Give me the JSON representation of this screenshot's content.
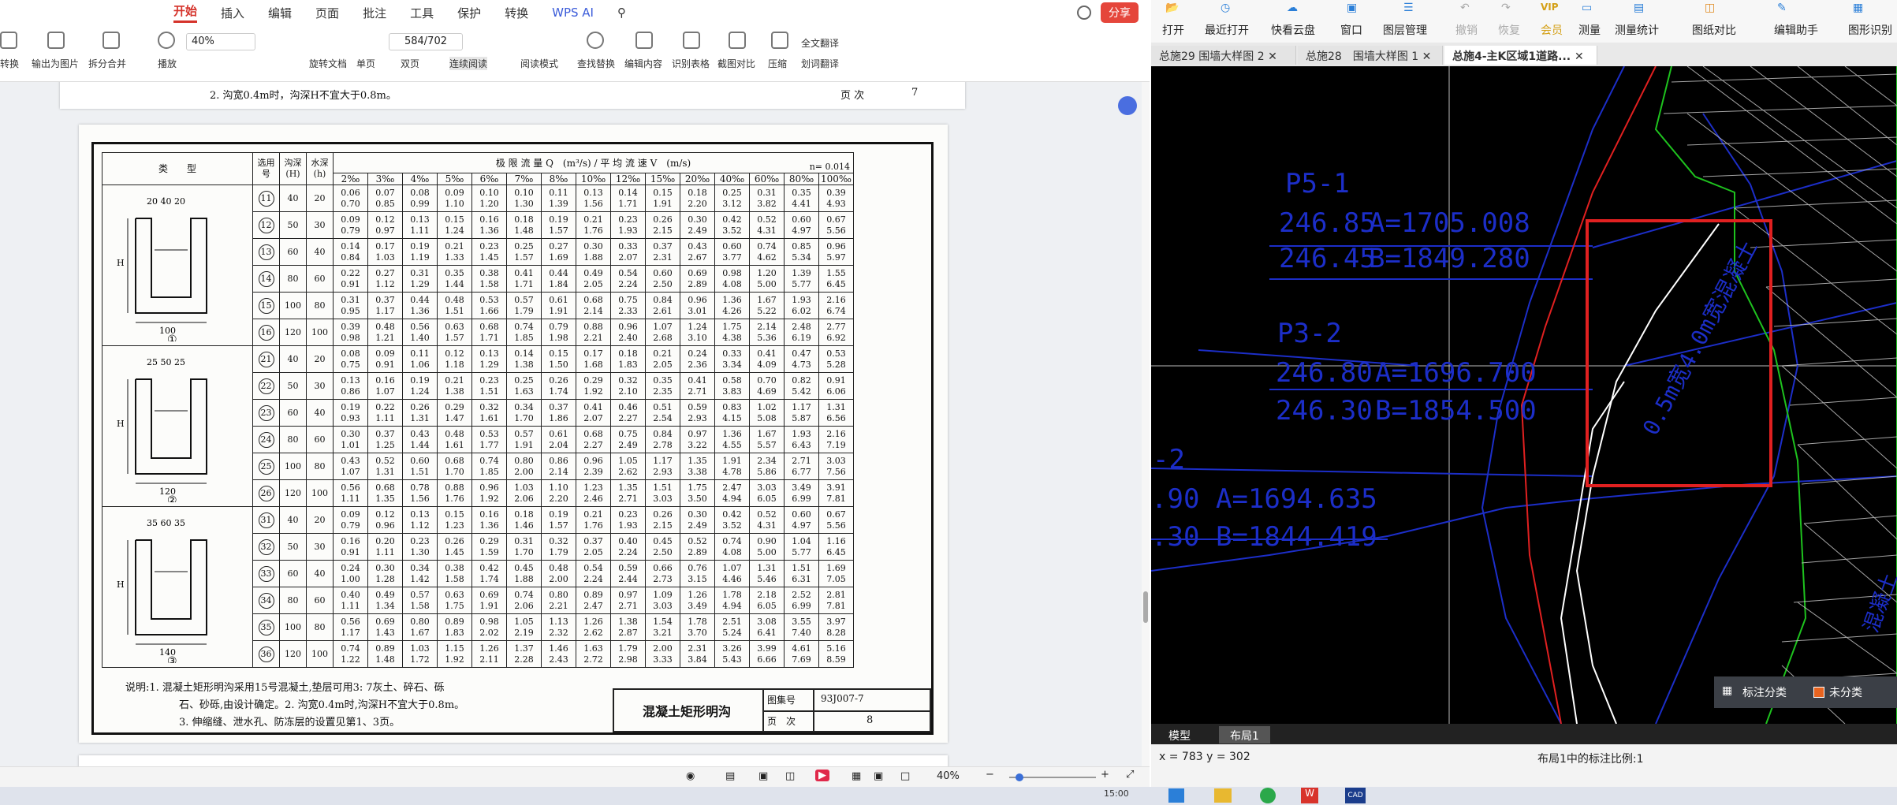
{
  "wps": {
    "menu": [
      "开始",
      "插入",
      "编辑",
      "页面",
      "批注",
      "工具",
      "保护",
      "转换",
      "WPS AI"
    ],
    "share_label": "分享",
    "ribbon": {
      "convert": "转换",
      "export_image": "输出为图片",
      "split_merge": "拆分合并",
      "play": "播放",
      "zoom": "40%",
      "page": "584/702",
      "rotate": "旋转文档",
      "single": "单页",
      "double": "双页",
      "continuous": "连续阅读",
      "read_mode": "阅读模式",
      "find_replace": "查找替换",
      "edit_content": "编辑内容",
      "recognize_table": "识别表格",
      "screenshot_compare": "截图对比",
      "compress": "压缩",
      "full_translate": "全文翻译",
      "word_translate": "划词翻译"
    },
    "prev_page": {
      "note": "2. 沟宽0.4m时，沟深H不宜大于0.8m。",
      "page_label": "页 次",
      "page_no": "7"
    },
    "drawing": {
      "header_type": "类　　型",
      "header_select": "选用号",
      "header_depth": "沟深(H)",
      "header_water": "水深(h)",
      "header_main": "极 限 流 量 Q　(m³/s) / 平 均 流 速 V　(m/s)",
      "n_value": "n= 0.014",
      "slopes": [
        "2‰",
        "3‰",
        "4‰",
        "5‰",
        "6‰",
        "7‰",
        "8‰",
        "10‰",
        "12‰",
        "15‰",
        "20‰",
        "40‰",
        "60‰",
        "80‰",
        "100‰"
      ],
      "groups": [
        {
          "label": "①",
          "dims": "20 40 20",
          "bottom": "100",
          "rows": [
            {
              "no": "11",
              "H": "40",
              "h": "20",
              "q": [
                "0.06",
                "0.07",
                "0.08",
                "0.09",
                "0.10",
                "0.10",
                "0.11",
                "0.13",
                "0.14",
                "0.15",
                "0.18",
                "0.25",
                "0.31",
                "0.35",
                "0.39"
              ],
              "v": [
                "0.70",
                "0.85",
                "0.99",
                "1.10",
                "1.20",
                "1.30",
                "1.39",
                "1.56",
                "1.71",
                "1.91",
                "2.20",
                "3.12",
                "3.82",
                "4.41",
                "4.93"
              ]
            },
            {
              "no": "12",
              "H": "50",
              "h": "30",
              "q": [
                "0.09",
                "0.12",
                "0.13",
                "0.15",
                "0.16",
                "0.18",
                "0.19",
                "0.21",
                "0.23",
                "0.26",
                "0.30",
                "0.42",
                "0.52",
                "0.60",
                "0.67"
              ],
              "v": [
                "0.79",
                "0.97",
                "1.11",
                "1.24",
                "1.36",
                "1.48",
                "1.57",
                "1.76",
                "1.93",
                "2.15",
                "2.49",
                "3.52",
                "4.31",
                "4.97",
                "5.56"
              ]
            },
            {
              "no": "13",
              "H": "60",
              "h": "40",
              "q": [
                "0.14",
                "0.17",
                "0.19",
                "0.21",
                "0.23",
                "0.25",
                "0.27",
                "0.30",
                "0.33",
                "0.37",
                "0.43",
                "0.60",
                "0.74",
                "0.85",
                "0.96"
              ],
              "v": [
                "0.84",
                "1.03",
                "1.19",
                "1.33",
                "1.45",
                "1.57",
                "1.69",
                "1.88",
                "2.07",
                "2.31",
                "2.67",
                "3.77",
                "4.62",
                "5.34",
                "5.97"
              ]
            },
            {
              "no": "14",
              "H": "80",
              "h": "60",
              "q": [
                "0.22",
                "0.27",
                "0.31",
                "0.35",
                "0.38",
                "0.41",
                "0.44",
                "0.49",
                "0.54",
                "0.60",
                "0.69",
                "0.98",
                "1.20",
                "1.39",
                "1.55"
              ],
              "v": [
                "0.91",
                "1.12",
                "1.29",
                "1.44",
                "1.58",
                "1.71",
                "1.84",
                "2.05",
                "2.24",
                "2.50",
                "2.89",
                "4.08",
                "5.00",
                "5.77",
                "6.45"
              ]
            },
            {
              "no": "15",
              "H": "100",
              "h": "80",
              "q": [
                "0.31",
                "0.37",
                "0.44",
                "0.48",
                "0.53",
                "0.57",
                "0.61",
                "0.68",
                "0.75",
                "0.84",
                "0.96",
                "1.36",
                "1.67",
                "1.93",
                "2.16"
              ],
              "v": [
                "0.95",
                "1.17",
                "1.36",
                "1.51",
                "1.66",
                "1.79",
                "1.91",
                "2.14",
                "2.33",
                "2.61",
                "3.01",
                "4.26",
                "5.22",
                "6.02",
                "6.74"
              ]
            },
            {
              "no": "16",
              "H": "120",
              "h": "100",
              "q": [
                "0.39",
                "0.48",
                "0.56",
                "0.63",
                "0.68",
                "0.74",
                "0.79",
                "0.88",
                "0.96",
                "1.07",
                "1.24",
                "1.75",
                "2.14",
                "2.48",
                "2.77"
              ],
              "v": [
                "0.98",
                "1.21",
                "1.40",
                "1.57",
                "1.71",
                "1.85",
                "1.98",
                "2.21",
                "2.40",
                "2.68",
                "3.10",
                "4.38",
                "5.36",
                "6.19",
                "6.92"
              ]
            }
          ]
        },
        {
          "label": "②",
          "dims": "25 50 25",
          "bottom": "120",
          "rows": [
            {
              "no": "21",
              "H": "40",
              "h": "20",
              "q": [
                "0.08",
                "0.09",
                "0.11",
                "0.12",
                "0.13",
                "0.14",
                "0.15",
                "0.17",
                "0.18",
                "0.21",
                "0.24",
                "0.33",
                "0.41",
                "0.47",
                "0.53"
              ],
              "v": [
                "0.75",
                "0.91",
                "1.06",
                "1.18",
                "1.29",
                "1.38",
                "1.50",
                "1.68",
                "1.83",
                "2.05",
                "2.36",
                "3.34",
                "4.09",
                "4.73",
                "5.28"
              ]
            },
            {
              "no": "22",
              "H": "50",
              "h": "30",
              "q": [
                "0.13",
                "0.16",
                "0.19",
                "0.21",
                "0.23",
                "0.25",
                "0.26",
                "0.29",
                "0.32",
                "0.35",
                "0.41",
                "0.58",
                "0.70",
                "0.82",
                "0.91"
              ],
              "v": [
                "0.86",
                "1.07",
                "1.24",
                "1.38",
                "1.51",
                "1.63",
                "1.74",
                "1.92",
                "2.10",
                "2.35",
                "2.71",
                "3.83",
                "4.69",
                "5.42",
                "6.06"
              ]
            },
            {
              "no": "23",
              "H": "60",
              "h": "40",
              "q": [
                "0.19",
                "0.22",
                "0.26",
                "0.29",
                "0.32",
                "0.34",
                "0.37",
                "0.41",
                "0.46",
                "0.51",
                "0.59",
                "0.83",
                "1.02",
                "1.17",
                "1.31"
              ],
              "v": [
                "0.93",
                "1.11",
                "1.31",
                "1.47",
                "1.61",
                "1.70",
                "1.86",
                "2.07",
                "2.27",
                "2.54",
                "2.93",
                "4.15",
                "5.08",
                "5.87",
                "6.56"
              ]
            },
            {
              "no": "24",
              "H": "80",
              "h": "60",
              "q": [
                "0.30",
                "0.37",
                "0.43",
                "0.48",
                "0.53",
                "0.57",
                "0.61",
                "0.68",
                "0.75",
                "0.84",
                "0.97",
                "1.36",
                "1.67",
                "1.93",
                "2.16"
              ],
              "v": [
                "1.01",
                "1.25",
                "1.44",
                "1.61",
                "1.77",
                "1.91",
                "2.04",
                "2.27",
                "2.49",
                "2.78",
                "3.22",
                "4.55",
                "5.57",
                "6.43",
                "7.19"
              ]
            },
            {
              "no": "25",
              "H": "100",
              "h": "80",
              "q": [
                "0.43",
                "0.52",
                "0.60",
                "0.68",
                "0.74",
                "0.80",
                "0.86",
                "0.96",
                "1.05",
                "1.17",
                "1.35",
                "1.91",
                "2.34",
                "2.71",
                "3.03"
              ],
              "v": [
                "1.07",
                "1.31",
                "1.51",
                "1.70",
                "1.85",
                "2.00",
                "2.14",
                "2.39",
                "2.62",
                "2.93",
                "3.38",
                "4.78",
                "5.86",
                "6.77",
                "7.56"
              ]
            },
            {
              "no": "26",
              "H": "120",
              "h": "100",
              "q": [
                "0.56",
                "0.68",
                "0.78",
                "0.88",
                "0.96",
                "1.03",
                "1.10",
                "1.23",
                "1.35",
                "1.51",
                "1.75",
                "2.47",
                "3.03",
                "3.49",
                "3.91"
              ],
              "v": [
                "1.11",
                "1.35",
                "1.56",
                "1.76",
                "1.92",
                "2.06",
                "2.20",
                "2.46",
                "2.71",
                "3.03",
                "3.50",
                "4.94",
                "6.05",
                "6.99",
                "7.81"
              ]
            }
          ]
        },
        {
          "label": "③",
          "dims": "35 60 35",
          "bottom": "140",
          "rows": [
            {
              "no": "31",
              "H": "40",
              "h": "20",
              "q": [
                "0.09",
                "0.12",
                "0.13",
                "0.15",
                "0.16",
                "0.18",
                "0.19",
                "0.21",
                "0.23",
                "0.26",
                "0.30",
                "0.42",
                "0.52",
                "0.60",
                "0.67"
              ],
              "v": [
                "0.79",
                "0.96",
                "1.12",
                "1.23",
                "1.36",
                "1.46",
                "1.57",
                "1.76",
                "1.93",
                "2.15",
                "2.49",
                "3.52",
                "4.31",
                "4.97",
                "5.56"
              ]
            },
            {
              "no": "32",
              "H": "50",
              "h": "30",
              "q": [
                "0.16",
                "0.20",
                "0.23",
                "0.26",
                "0.29",
                "0.31",
                "0.32",
                "0.37",
                "0.40",
                "0.45",
                "0.52",
                "0.74",
                "0.90",
                "1.04",
                "1.16"
              ],
              "v": [
                "0.91",
                "1.11",
                "1.30",
                "1.45",
                "1.59",
                "1.70",
                "1.79",
                "2.05",
                "2.24",
                "2.50",
                "2.89",
                "4.08",
                "5.00",
                "5.77",
                "6.45"
              ]
            },
            {
              "no": "33",
              "H": "60",
              "h": "40",
              "q": [
                "0.24",
                "0.30",
                "0.34",
                "0.38",
                "0.42",
                "0.45",
                "0.48",
                "0.54",
                "0.59",
                "0.66",
                "0.76",
                "1.07",
                "1.31",
                "1.51",
                "1.69"
              ],
              "v": [
                "1.00",
                "1.28",
                "1.42",
                "1.58",
                "1.74",
                "1.88",
                "2.00",
                "2.24",
                "2.44",
                "2.73",
                "3.15",
                "4.46",
                "5.46",
                "6.31",
                "7.05"
              ]
            },
            {
              "no": "34",
              "H": "80",
              "h": "60",
              "q": [
                "0.40",
                "0.49",
                "0.57",
                "0.63",
                "0.69",
                "0.74",
                "0.80",
                "0.89",
                "0.97",
                "1.09",
                "1.26",
                "1.78",
                "2.18",
                "2.52",
                "2.81"
              ],
              "v": [
                "1.11",
                "1.34",
                "1.58",
                "1.75",
                "1.91",
                "2.06",
                "2.21",
                "2.47",
                "2.71",
                "3.03",
                "3.49",
                "4.94",
                "6.05",
                "6.99",
                "7.81"
              ]
            },
            {
              "no": "35",
              "H": "100",
              "h": "80",
              "q": [
                "0.56",
                "0.69",
                "0.80",
                "0.89",
                "0.98",
                "1.05",
                "1.13",
                "1.26",
                "1.38",
                "1.54",
                "1.78",
                "2.51",
                "3.08",
                "3.55",
                "3.97"
              ],
              "v": [
                "1.17",
                "1.43",
                "1.67",
                "1.83",
                "2.02",
                "2.19",
                "2.32",
                "2.62",
                "2.87",
                "3.21",
                "3.70",
                "5.24",
                "6.41",
                "7.40",
                "8.28"
              ]
            },
            {
              "no": "36",
              "H": "120",
              "h": "100",
              "q": [
                "0.74",
                "0.89",
                "1.03",
                "1.15",
                "1.26",
                "1.37",
                "1.46",
                "1.63",
                "1.79",
                "2.00",
                "2.31",
                "3.26",
                "3.99",
                "4.61",
                "5.16"
              ],
              "v": [
                "1.22",
                "1.48",
                "1.72",
                "1.92",
                "2.11",
                "2.28",
                "2.43",
                "2.72",
                "2.98",
                "3.33",
                "3.84",
                "5.43",
                "6.66",
                "7.69",
                "8.59"
              ]
            }
          ]
        }
      ],
      "notes": [
        "说明:1. 混凝土矩形明沟采用15号混凝土,垫层可用3: 7灰土、碎石、砾",
        "石、砂砾,由设计确定。2. 沟宽0.4m时,沟深H不宜大于0.8m。",
        "3. 伸缩缝、泄水孔、防冻层的设置见第1、3页。"
      ],
      "title": "混凝土矩形明沟",
      "atlas_label": "图集号",
      "atlas_no": "93J007-7",
      "page_label": "页　次",
      "page_no": "8"
    },
    "status": {
      "zoom": "40%"
    },
    "clock": "15:00"
  },
  "cad": {
    "toolbar": [
      "打开",
      "最近打开",
      "快看云盘",
      "窗口",
      "图层管理",
      "撤销",
      "恢复",
      "会员",
      "测量",
      "测量统计",
      "图纸对比",
      "编辑助手",
      "图形识别"
    ],
    "tabs": [
      "总施29 围墙大样图 2",
      "总施28　围墙大样图 1",
      "总施4-主K区域1道路..."
    ],
    "drawing_text": {
      "p5": "P5-1",
      "p5_a_elev": "246.85",
      "p5_a": "A=1705.008",
      "p5_b_elev": "246.45",
      "p5_b": "B=1849.280",
      "p3": "P3-2",
      "p3_a_elev": "246.80",
      "p3_a": "A=1696.700",
      "p3_b_elev": "246.30",
      "p3_b": "B=1854.500",
      "p_left": "-2",
      "pl_a_elev": ".90",
      "pl_a": "A=1694.635",
      "pl_b_elev": ".30",
      "pl_b": "B=1844.419",
      "road": "0.5m宽4.0m宽混凝土",
      "road2": "混凝土"
    },
    "legend": {
      "mark": "标注分类",
      "unclassified": "未分类"
    },
    "bottom_tabs": [
      "模型",
      "布局1"
    ],
    "status": {
      "coords": "x = 783  y = 302",
      "scale": "布局1中的标注比例:1"
    },
    "colors": {
      "cad_blue": "#1c2ec8",
      "cad_green": "#1ec21e",
      "cad_red": "#e02020",
      "cad_bg": "#000000"
    }
  }
}
